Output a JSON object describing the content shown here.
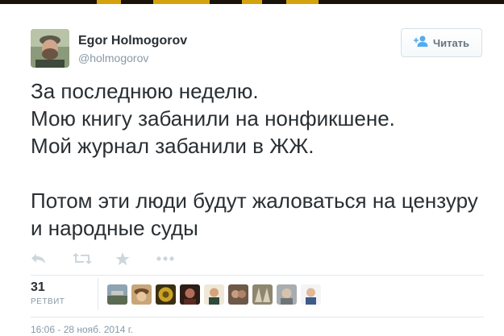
{
  "tweet": {
    "author_name": "Egor Holmogorov",
    "author_handle": "@holmogorov",
    "follow_label": "Читать",
    "text": "За последнюю неделю.\nМою книгу забанили на нонфикшене.\nМой журнал забанили в ЖЖ.\n\nПотом эти люди будут жаловаться на цензуру и народные суды",
    "retweet_count": "31",
    "retweet_label": "РЕТВИТ",
    "timestamp": "16:06 - 28 нояб. 2014 г."
  },
  "actions": [
    {
      "name": "reply-icon"
    },
    {
      "name": "retweet-icon"
    },
    {
      "name": "favorite-icon"
    },
    {
      "name": "more-icon"
    }
  ],
  "retweeter_avatars": 9,
  "colors": {
    "text": "#292f33",
    "muted": "#8899a6",
    "icon": "#ccd6dd",
    "divider": "#e1e8ed",
    "follow_icon": "#55acee"
  }
}
